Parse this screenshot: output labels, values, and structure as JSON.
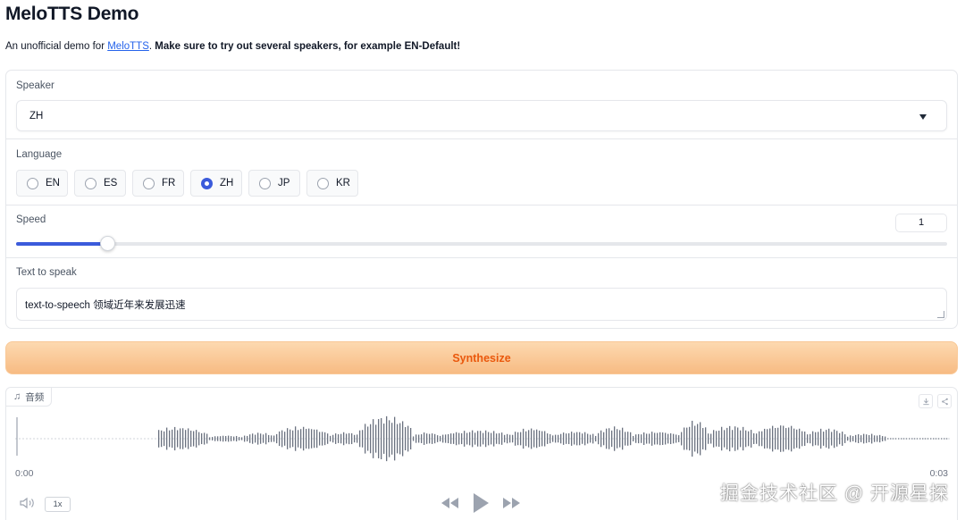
{
  "page": {
    "title": "MeloTTS Demo",
    "subtitle_prefix": "An unofficial demo for ",
    "subtitle_link": "MeloTTS",
    "subtitle_dot": ".",
    "subtitle_bold": " Make sure to try out several speakers, for example EN-Default!"
  },
  "speaker": {
    "label": "Speaker",
    "value": "ZH"
  },
  "language": {
    "label": "Language",
    "options": [
      "EN",
      "ES",
      "FR",
      "ZH",
      "JP",
      "KR"
    ],
    "selected": "ZH"
  },
  "speed": {
    "label": "Speed",
    "value": "1",
    "fraction": 0.098
  },
  "text": {
    "label": "Text to speak",
    "value": "text-to-speech 领域近年来发展迅速"
  },
  "synthesize": {
    "label": "Synthesize"
  },
  "audio": {
    "tag": "音频",
    "time_start": "0:00",
    "time_end": "0:03",
    "rate": "1x"
  },
  "watermark": "掘金技术社区 @ 开源星探",
  "colors": {
    "accent": "#3b5bdb",
    "button_text": "#ea580c",
    "wave": "#6b7280"
  }
}
